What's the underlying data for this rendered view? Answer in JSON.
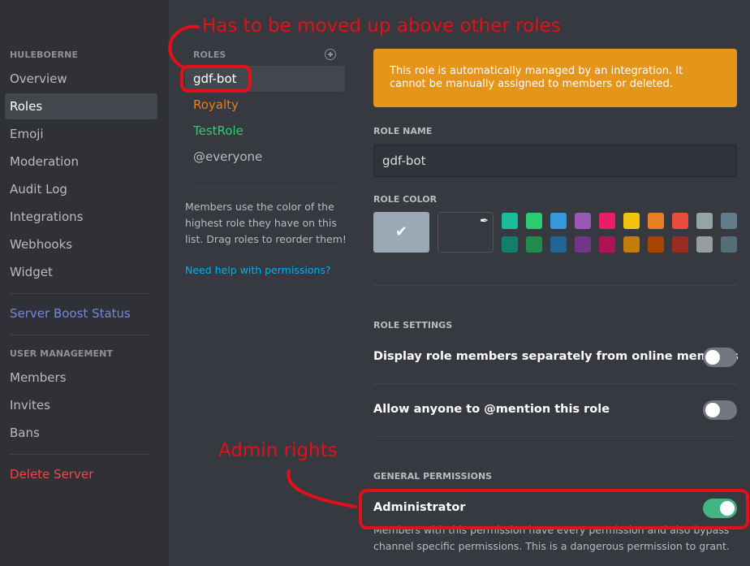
{
  "sidebar": {
    "server_header": "HULEBOERNE",
    "items": [
      {
        "label": "Overview"
      },
      {
        "label": "Roles"
      },
      {
        "label": "Emoji"
      },
      {
        "label": "Moderation"
      },
      {
        "label": "Audit Log"
      },
      {
        "label": "Integrations"
      },
      {
        "label": "Webhooks"
      },
      {
        "label": "Widget"
      }
    ],
    "boost_label": "Server Boost Status",
    "user_mgmt_header": "USER MANAGEMENT",
    "user_items": [
      {
        "label": "Members"
      },
      {
        "label": "Invites"
      },
      {
        "label": "Bans"
      }
    ],
    "delete_label": "Delete Server"
  },
  "roles": {
    "header": "ROLES",
    "list": [
      {
        "name": "gdf-bot",
        "color": "#ffffff"
      },
      {
        "name": "Royalty",
        "color": "#e67e22"
      },
      {
        "name": "TestRole",
        "color": "#2ecc71"
      },
      {
        "name": "@everyone",
        "color": "#b9bbbe"
      }
    ],
    "note": "Members use the color of the highest role they have on this list. Drag roles to reorder them!",
    "help_link": "Need help with permissions?"
  },
  "main": {
    "banner": "This role is automatically managed by an integration. It cannot be manually assigned to members or deleted.",
    "role_name_label": "ROLE NAME",
    "role_name_value": "gdf-bot",
    "role_color_label": "ROLE COLOR",
    "colors_row1": [
      "#1abc9c",
      "#2ecc71",
      "#3498db",
      "#9b59b6",
      "#e91e63",
      "#f1c40f",
      "#e67e22",
      "#e74c3c",
      "#95a5a6",
      "#607d8b"
    ],
    "colors_row2": [
      "#11806a",
      "#1f8b4c",
      "#206694",
      "#71368a",
      "#ad1457",
      "#c27c0e",
      "#a84300",
      "#992d22",
      "#979c9f",
      "#546e7a"
    ],
    "default_color": "#99aab5",
    "role_settings_label": "ROLE SETTINGS",
    "setting_display_separately": "Display role members separately from online members",
    "setting_mention_prefix": "Allow anyone to ",
    "setting_mention_bold": "@mention",
    "setting_mention_suffix": " this role",
    "general_permissions_label": "GENERAL PERMISSIONS",
    "administrator_label": "Administrator",
    "administrator_desc": "Members with this permission have every permission and also bypass channel specific permissions. This is a dangerous permission to grant.",
    "toggle_display_separately": false,
    "toggle_mention": false,
    "toggle_administrator": true
  },
  "annotations": {
    "top_note": "Has to be moved up above other roles",
    "admin_note": "Admin rights",
    "color": "#e3101a"
  }
}
